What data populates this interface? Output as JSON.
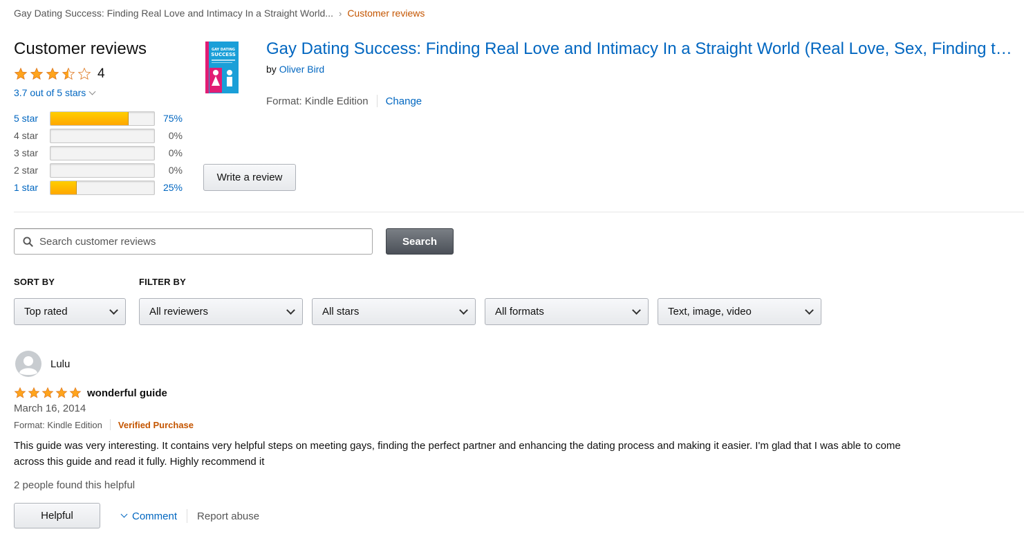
{
  "breadcrumb": {
    "product": "Gay Dating Success: Finding Real Love and Intimacy In a Straight World...",
    "separator": "›",
    "current": "Customer reviews"
  },
  "summary": {
    "heading": "Customer reviews",
    "rating_value": 3.7,
    "rating_count": "4",
    "out_of": "3.7 out of 5 stars",
    "histogram": [
      {
        "label": "5 star",
        "percent_text": "75%",
        "fraction": 0.75,
        "linked": true
      },
      {
        "label": "4 star",
        "percent_text": "0%",
        "fraction": 0,
        "linked": false
      },
      {
        "label": "3 star",
        "percent_text": "0%",
        "fraction": 0,
        "linked": false
      },
      {
        "label": "2 star",
        "percent_text": "0%",
        "fraction": 0,
        "linked": false
      },
      {
        "label": "1 star",
        "percent_text": "25%",
        "fraction": 0.25,
        "linked": true
      }
    ]
  },
  "product": {
    "title": "Gay Dating Success: Finding Real Love and Intimacy In a Straight World (Real Love, Sex, Finding the Perfect Partner)",
    "by_label": "by",
    "author": "Oliver Bird",
    "format_text": "Format: Kindle Edition",
    "change_label": "Change",
    "cover_text": [
      "GAY DATING",
      "SUCCESS"
    ],
    "write_review_label": "Write a review"
  },
  "search": {
    "placeholder": "Search customer reviews",
    "button_label": "Search"
  },
  "filters": {
    "sort_by_label": "SORT BY",
    "filter_by_label": "FILTER BY",
    "sort_value": "Top rated",
    "reviewers_value": "All reviewers",
    "stars_value": "All stars",
    "formats_value": "All formats",
    "media_value": "Text, image, video"
  },
  "review": {
    "reviewer": "Lulu",
    "rating": 5,
    "title": "wonderful guide",
    "date": "March 16, 2014",
    "format": "Format: Kindle Edition",
    "verified": "Verified Purchase",
    "body": "This guide was very interesting. It contains very helpful steps on meeting gays, finding the perfect partner and enhancing the dating process and making it easier. I'm glad that I was able to come across this guide and read it fully. Highly recommend it",
    "helpful_count": "2 people found this helpful",
    "helpful_label": "Helpful",
    "comment_label": "Comment",
    "report_label": "Report abuse"
  },
  "colors": {
    "link": "#0066c0",
    "star": "#ffa41c",
    "verified": "#c45500",
    "bar_fill": "#ffa700"
  }
}
